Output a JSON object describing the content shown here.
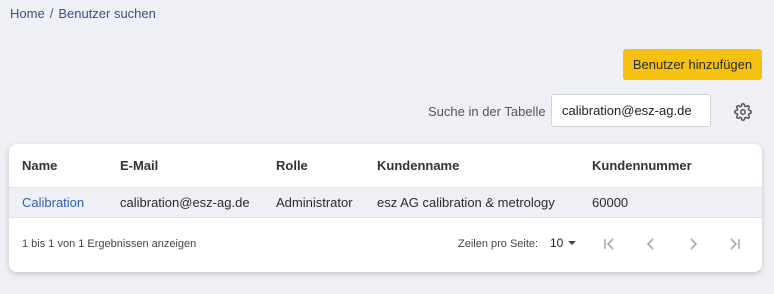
{
  "breadcrumb": {
    "home": "Home",
    "separator": "/",
    "current": "Benutzer suchen"
  },
  "toolbar": {
    "add_user_label": "Benutzer hinzufügen"
  },
  "search": {
    "label": "Suche in der Tabelle",
    "value": "calibration@esz-ag.de"
  },
  "icons": {
    "settings": "gear-icon",
    "first": "first-page-icon",
    "prev": "chevron-left-icon",
    "next": "chevron-right-icon",
    "last": "last-page-icon",
    "dropdown": "caret-down-icon"
  },
  "table": {
    "headers": [
      "Name",
      "E-Mail",
      "Rolle",
      "Kundenname",
      "Kundennummer"
    ],
    "rows": [
      [
        "Calibration",
        "calibration@esz-ag.de",
        "Administrator",
        "esz AG calibration & metrology",
        "60000"
      ]
    ]
  },
  "pagination": {
    "summary": "1 bis 1 von 1 Ergebnissen anzeigen",
    "per_page_label": "Zeilen pro Seite:",
    "per_page_value": "10"
  },
  "colors": {
    "accent": "#f5c211",
    "link": "#2f5fb0",
    "background": "#eef0f6"
  }
}
